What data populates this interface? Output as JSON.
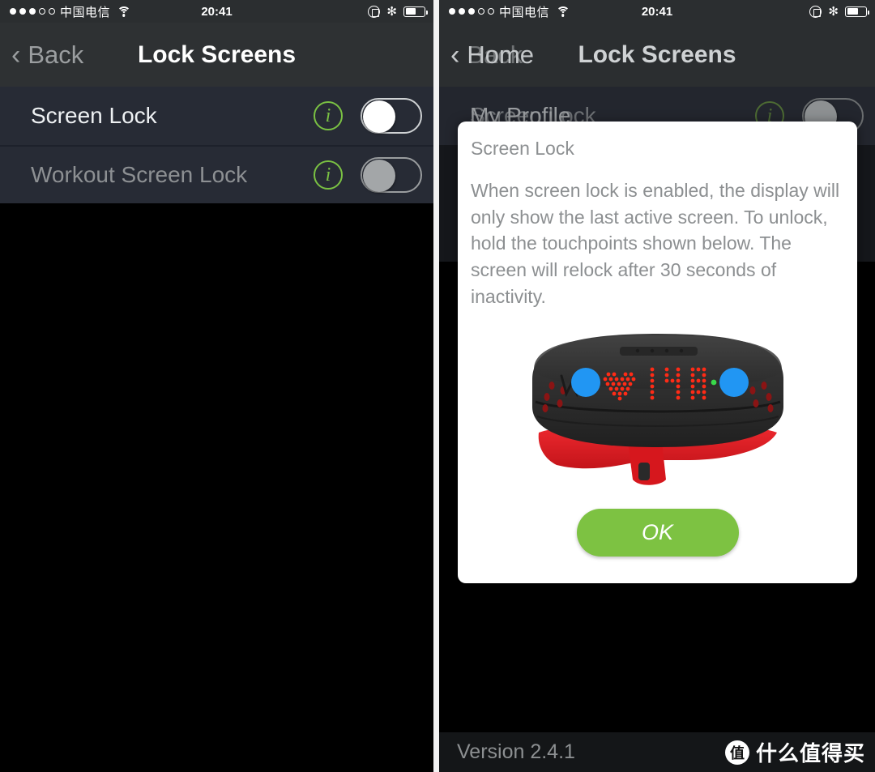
{
  "status_bar": {
    "signal_dots_filled": 3,
    "signal_dots_total": 5,
    "carrier": "中国电信",
    "wifi_icon": "wifi-icon",
    "time": "20:41",
    "rotation_lock_icon": "rotation-lock-icon",
    "bluetooth_icon": "bluetooth-icon",
    "bluetooth_glyph": "✻",
    "battery_percent": 55
  },
  "left_screen": {
    "nav": {
      "back_label": "Back",
      "back_chevron": "‹",
      "title": "Lock Screens"
    },
    "rows": [
      {
        "label": "Screen Lock",
        "info": "i",
        "toggle_state": "off",
        "enabled": true
      },
      {
        "label": "Workout Screen Lock",
        "info": "i",
        "toggle_state": "off",
        "enabled": false
      }
    ]
  },
  "right_screen": {
    "nav": {
      "back_label": "Back",
      "incoming_back_label": "Home",
      "back_chevron": "‹",
      "title": "Lock Screens"
    },
    "rows": [
      {
        "label": "Screen Lock",
        "incoming_label": "My Profile",
        "info": "i",
        "toggle_state": "off"
      }
    ],
    "dialog": {
      "title": "Screen Lock",
      "body": "When screen lock is enabled, the display will only show the last active screen. To unlock, hold the touchpoints shown below. The screen will relock after 30 seconds of inactivity.",
      "image_name": "fitness-band-illustration",
      "band": {
        "display_value": "148",
        "heart_icon": "heart-led-icon",
        "led_color": "#ff2b16",
        "touchpoint_color": "#2196f3",
        "strap_color": "#e01b22",
        "body_color": "#2e2e2e",
        "status_led_color": "#39d94a"
      },
      "ok_label": "OK",
      "ok_color": "#7dc242"
    },
    "bottom_bar": {
      "version": "Version 2.4.1",
      "watermark_badge": "值",
      "watermark_text": "什么值得买"
    }
  },
  "colors": {
    "accent_green": "#7ac143",
    "nav_bg": "#2e3133",
    "row_bg": "#272b35",
    "page_bg": "#000000"
  }
}
